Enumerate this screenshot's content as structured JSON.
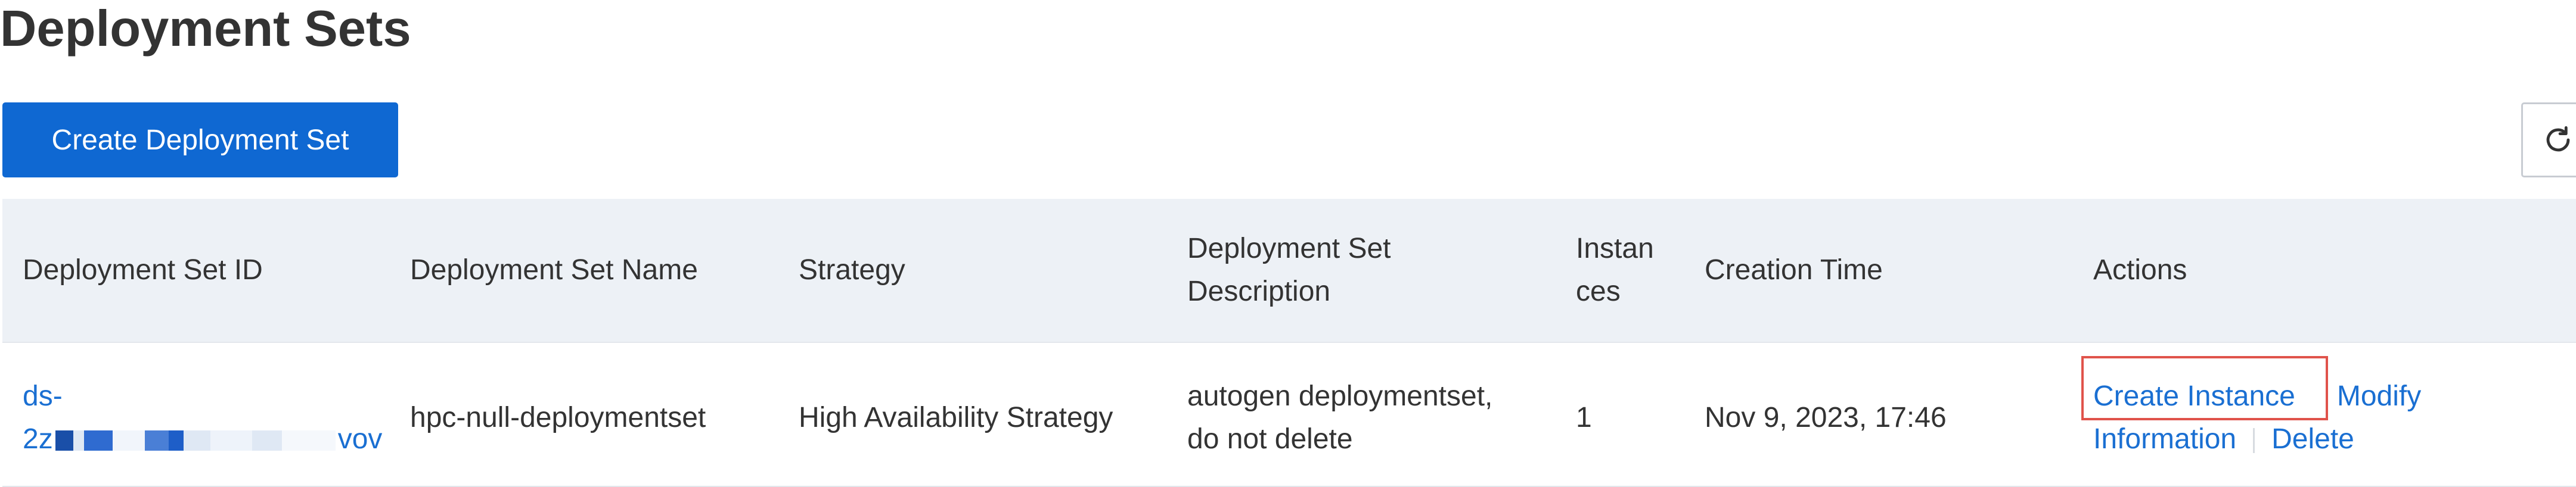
{
  "page": {
    "title": "Deployment Sets"
  },
  "toolbar": {
    "create_label": "Create Deployment Set",
    "refresh_icon": "refresh-icon"
  },
  "table": {
    "columns": {
      "id": "Deployment Set ID",
      "name": "Deployment Set Name",
      "strategy": "Strategy",
      "description_line1": "Deployment Set",
      "description_line2": "Description",
      "instances_line1": "Instan",
      "instances_line2": "ces",
      "creation_time": "Creation Time",
      "actions": "Actions"
    },
    "rows": [
      {
        "id_prefix": "ds-",
        "id_start": "2z",
        "id_end": "vov",
        "name": "hpc-null-deploymentset",
        "strategy": "High Availability Strategy",
        "description_line1": "autogen deploymentset,",
        "description_line2": "do not delete",
        "instances": "1",
        "creation_time": "Nov 9, 2023, 17:46",
        "actions": {
          "create_instance": "Create Instance",
          "modify_line1": "Modify",
          "modify_line2": "Information",
          "delete": "Delete"
        }
      }
    ]
  },
  "colors": {
    "primary": "#0f68d2",
    "link": "#1a6fd2",
    "header_bg": "#edf1f6",
    "highlight": "#e0534b"
  }
}
